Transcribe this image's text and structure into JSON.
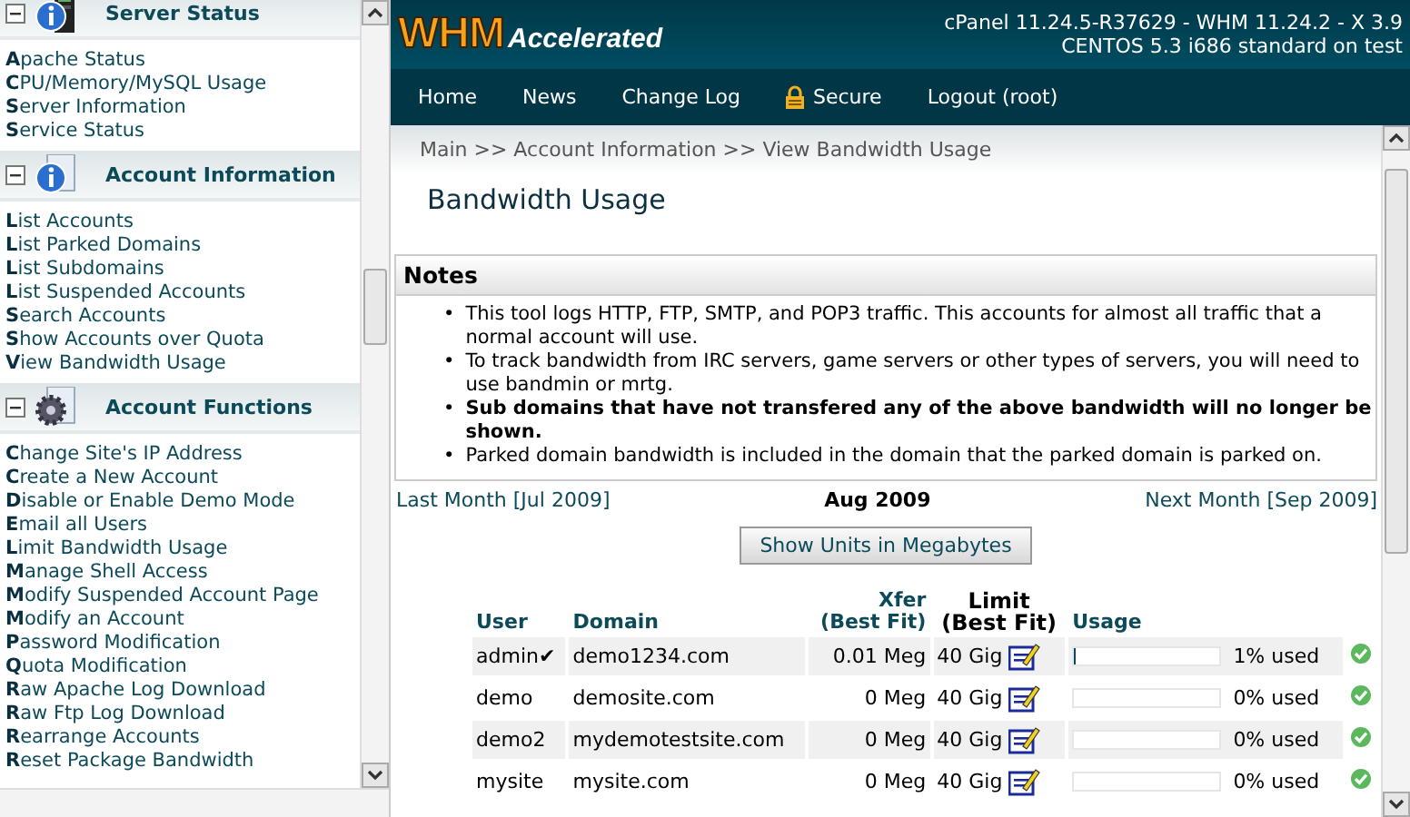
{
  "sidebar": {
    "sections": [
      {
        "title": "Server Status",
        "expanded": true,
        "items": [
          "Apache Status",
          "CPU/Memory/MySQL Usage",
          "Server Information",
          "Service Status"
        ]
      },
      {
        "title": "Account Information",
        "expanded": true,
        "items": [
          "List Accounts",
          "List Parked Domains",
          "List Subdomains",
          "List Suspended Accounts",
          "Search Accounts",
          "Show Accounts over Quota",
          "View Bandwidth Usage"
        ]
      },
      {
        "title": "Account Functions",
        "expanded": true,
        "items": [
          "Change Site's IP Address",
          "Create a New Account",
          "Disable or Enable Demo Mode",
          "Email all Users",
          "Limit Bandwidth Usage",
          "Manage Shell Access",
          "Modify Suspended Account Page",
          "Modify an Account",
          "Password Modification",
          "Quota Modification",
          "Raw Apache Log Download",
          "Raw Ftp Log Download",
          "Rearrange Accounts",
          "Reset Package Bandwidth"
        ]
      }
    ]
  },
  "header": {
    "logo_main": "WHM",
    "logo_sub": "Accelerated",
    "version_line": "cPanel 11.24.5-R37629 - WHM 11.24.2 - X 3.9",
    "system_line": "CENTOS 5.3 i686 standard on test"
  },
  "nav": [
    {
      "label": "Home",
      "kind": "link"
    },
    {
      "label": "News",
      "kind": "link"
    },
    {
      "label": "Change Log",
      "kind": "link"
    },
    {
      "label": "Secure",
      "kind": "lock"
    },
    {
      "label": "Logout (root)",
      "kind": "link"
    }
  ],
  "breadcrumb": "Main >> Account Information >> View Bandwidth Usage",
  "page_title": "Bandwidth Usage",
  "notes": {
    "title": "Notes",
    "marker": "•",
    "items": [
      {
        "text": "This tool logs HTTP, FTP, SMTP, and POP3 traffic. This accounts for almost all traffic that a normal account will use.",
        "bold": false
      },
      {
        "text": "To track bandwidth from IRC servers, game servers or other types of servers, you will need to use bandmin or mrtg.",
        "bold": false
      },
      {
        "text": "Sub domains that have not transfered any of the above bandwidth will no longer be shown.",
        "bold": true
      },
      {
        "text": "Parked domain bandwidth is included in the domain that the parked domain is parked on.",
        "bold": false
      }
    ]
  },
  "month_nav": {
    "previous": "Last Month [Jul 2009]",
    "current": "Aug 2009",
    "next": "Next Month [Sep 2009]"
  },
  "units_button": "Show Units in Megabytes",
  "table": {
    "columns": [
      {
        "label": "User",
        "sortable": true
      },
      {
        "label": "Domain",
        "sortable": true
      },
      {
        "label": "Xfer",
        "sub": "(Best Fit)",
        "sortable": true
      },
      {
        "label": "Limit",
        "sub": "(Best Fit)",
        "sortable": false
      },
      {
        "label": "Usage",
        "sortable": true
      }
    ],
    "rows": [
      {
        "user": "admin",
        "flag": "✔",
        "domain": "demo1234.com",
        "xfer": "0.01 Meg",
        "limit": "40 Gig",
        "level": 0.01,
        "usage": "1% used"
      },
      {
        "user": "demo",
        "domain": "demosite.com",
        "xfer": "0 Meg",
        "limit": "40 Gig",
        "level": 0,
        "usage": "0% used"
      },
      {
        "user": "demo2",
        "domain": "mydemotestsite.com",
        "xfer": "0 Meg",
        "limit": "40 Gig",
        "level": 0,
        "usage": "0% used"
      },
      {
        "user": "mysite",
        "domain": "mysite.com",
        "xfer": "0 Meg",
        "limit": "40 Gig",
        "level": 0,
        "usage": "0% used"
      }
    ]
  }
}
